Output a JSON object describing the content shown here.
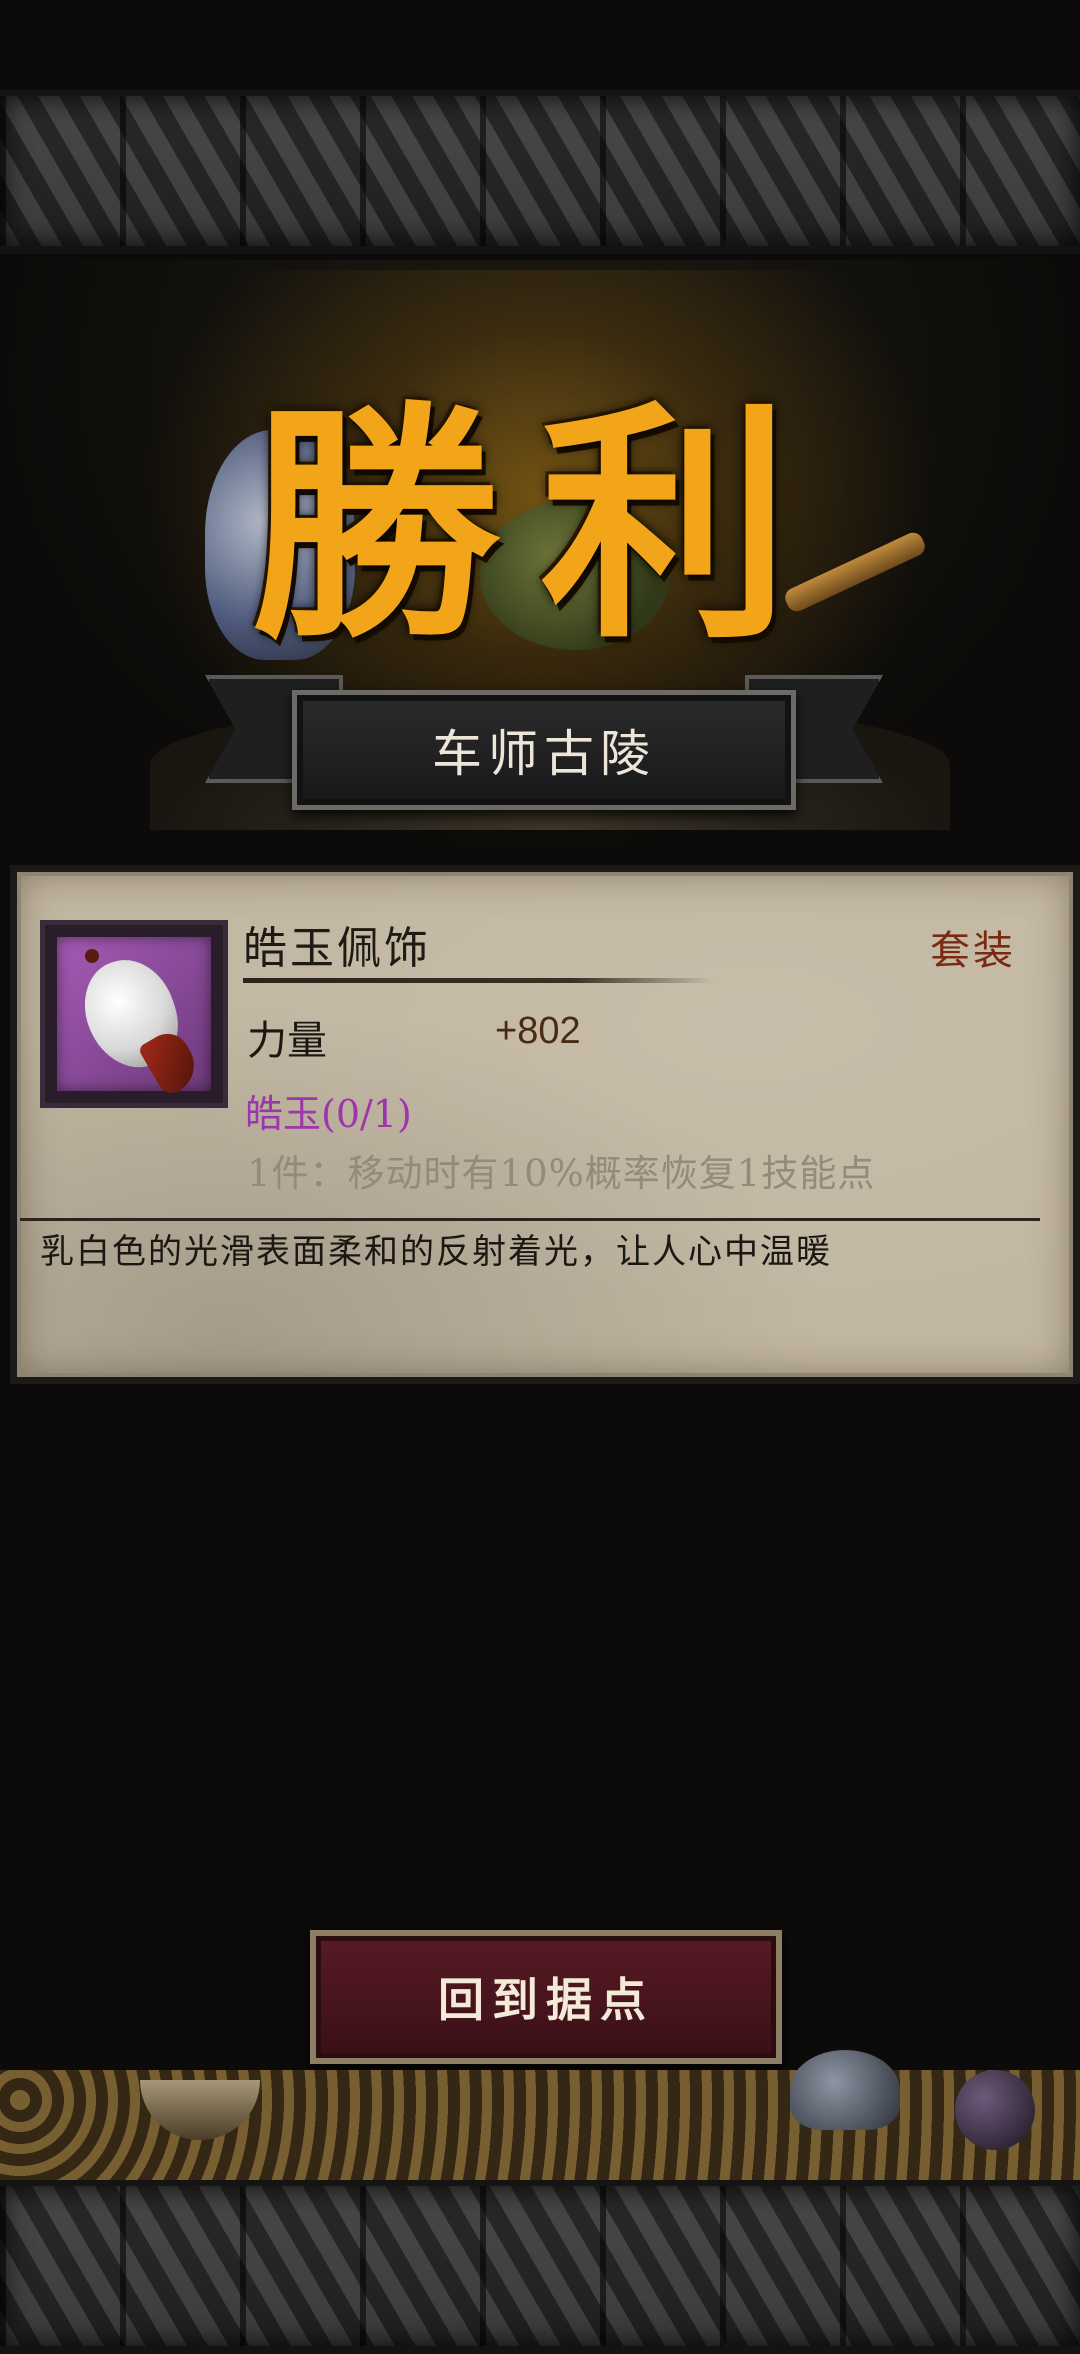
{
  "victory": {
    "title": "勝利",
    "location": "车师古陵"
  },
  "item": {
    "name": "皓玉佩饰",
    "tag": "套装",
    "stat_label": "力量",
    "stat_value": "+802",
    "set_name": "皓玉(0/1)",
    "set_bonus": "1件：移动时有10%概率恢复1技能点",
    "description": "乳白色的光滑表面柔和的反射着光，让人心中温暖",
    "icon": "jade-pendant-icon",
    "rarity_color": "#a55ab5"
  },
  "actions": {
    "return_label": "回到据点"
  },
  "colors": {
    "title": "#f3a51a",
    "set_name": "#9d35ad",
    "set_tag": "#7a2a12",
    "button_bg": "#571a24"
  }
}
